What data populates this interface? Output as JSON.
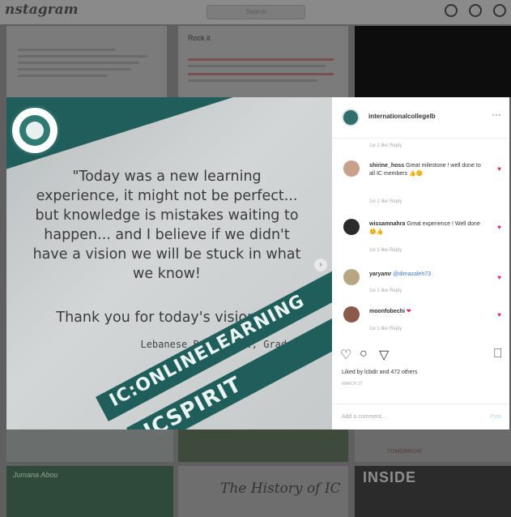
{
  "topbar": {
    "logo": "nstagram",
    "search_placeholder": "Search"
  },
  "feed": {
    "tile_texts": [
      "Rock it",
      "Jumana Abou",
      "The History of IC",
      "INSIDE",
      "TOMORROW"
    ]
  },
  "post": {
    "quote": "\"Today was a new learning experience, it might not be perfect... but knowledge is mistakes waiting to happen... and I believe if we didn't have a vision we will be stuck in what we know!",
    "thanks": "Thank you for today's vision :)\"",
    "attribution": "Lebanese Bac Parent, Grade 11",
    "banner1": "IC:ONLINELEARNING",
    "banner2": "ICSPIRIT"
  },
  "sidebar": {
    "username": "internationalcollegelb",
    "more": "···",
    "comments": [
      {
        "meta": "1w   1 like   Reply"
      },
      {
        "user": "shirine_hoss",
        "text": "Great milestone ! well done to all IC members 👍😊",
        "meta": "1w   1 like   Reply"
      },
      {
        "user": "wissamnahra",
        "text": "Great experience ! Well done 😊👍",
        "meta": "1w   1 like   Reply"
      },
      {
        "user": "yaryamr",
        "text": "@dimazaleh73",
        "meta": "1w   1 like   Reply"
      },
      {
        "user": "moonfobechi",
        "text": "❤",
        "meta": "1w   1 like   Reply"
      }
    ],
    "likes": "Liked by lcbdir and 472 others",
    "time_ago": "MARCH 17",
    "add_comment_placeholder": "Add a comment...",
    "post_label": "Post"
  },
  "colors": {
    "brand_teal": "#1f5e5b",
    "like_red": "#e0245e"
  }
}
